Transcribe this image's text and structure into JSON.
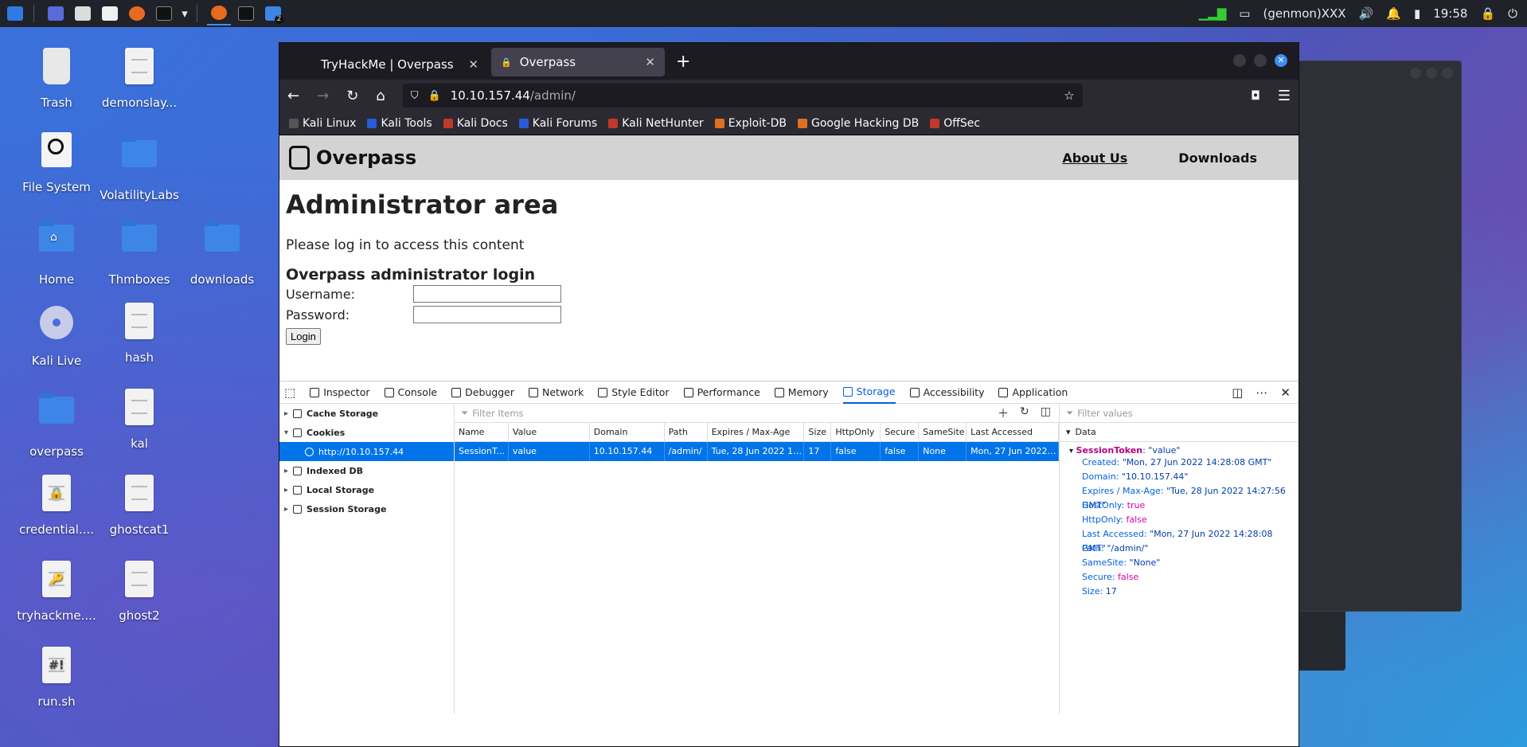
{
  "panel": {
    "status_text": "(genmon)XXX",
    "clock": "19:58",
    "workspace_badge": "2"
  },
  "desktop_icons": [
    {
      "label": "Trash",
      "type": "trash"
    },
    {
      "label": "demonslay...",
      "type": "doc"
    },
    {
      "label": "File System",
      "type": "drive"
    },
    {
      "label": "VolatilityLabs",
      "type": "folder"
    },
    {
      "label": "Home",
      "type": "home"
    },
    {
      "label": "Thmboxes",
      "type": "folder"
    },
    {
      "label": "downloads",
      "type": "folder"
    },
    {
      "label": "Kali Live",
      "type": "disc"
    },
    {
      "label": "hash",
      "type": "doc"
    },
    {
      "label": "overpass",
      "type": "folder"
    },
    {
      "label": "kal",
      "type": "doc"
    },
    {
      "label": "credential....",
      "type": "lockdoc"
    },
    {
      "label": "ghostcat1",
      "type": "doc"
    },
    {
      "label": "tryhackme....",
      "type": "keydoc"
    },
    {
      "label": "ghost2",
      "type": "doc"
    },
    {
      "label": "run.sh",
      "type": "script"
    }
  ],
  "browser": {
    "tabs": [
      {
        "title": "TryHackMe | Overpass"
      },
      {
        "title": "Overpass"
      }
    ],
    "url_host": "10.10.157.44",
    "url_path": "/admin/",
    "bookmarks": [
      "Kali Linux",
      "Kali Tools",
      "Kali Docs",
      "Kali Forums",
      "Kali NetHunter",
      "Exploit-DB",
      "Google Hacking DB",
      "OffSec"
    ]
  },
  "site": {
    "logo_text": "Overpass",
    "nav": [
      "About Us",
      "Downloads"
    ],
    "heading": "Administrator area",
    "message": "Please log in to access this content",
    "login_title": "Overpass administrator login",
    "username_label": "Username:",
    "password_label": "Password:",
    "login_button": "Login"
  },
  "devtools": {
    "tabs": [
      "Inspector",
      "Console",
      "Debugger",
      "Network",
      "Style Editor",
      "Performance",
      "Memory",
      "Storage",
      "Accessibility",
      "Application"
    ],
    "selected_tab": "Storage",
    "tree": [
      "Cache Storage",
      "Cookies",
      "http://10.10.157.44",
      "Indexed DB",
      "Local Storage",
      "Session Storage"
    ],
    "filter_items_placeholder": "Filter Items",
    "filter_values_placeholder": "Filter values",
    "columns": [
      "Name",
      "Value",
      "Domain",
      "Path",
      "Expires / Max-Age",
      "Size",
      "HttpOnly",
      "Secure",
      "SameSite",
      "Last Accessed"
    ],
    "row": [
      "SessionT...",
      "value",
      "10.10.157.44",
      "/admin/",
      "Tue, 28 Jun 2022 14:...",
      "17",
      "false",
      "false",
      "None",
      "Mon, 27 Jun 2022 14..."
    ],
    "data_header": "Data",
    "token_name": "SessionToken",
    "token_value": ": \"value\"",
    "details": [
      {
        "k": "Created",
        "v": "\"Mon, 27 Jun 2022 14:28:08 GMT\""
      },
      {
        "k": "Domain",
        "v": "\"10.10.157.44\""
      },
      {
        "k": "Expires / Max-Age",
        "v": "\"Tue, 28 Jun 2022 14:27:56 GMT\""
      },
      {
        "k": "HostOnly",
        "v": "true"
      },
      {
        "k": "HttpOnly",
        "v": "false"
      },
      {
        "k": "Last Accessed",
        "v": "\"Mon, 27 Jun 2022 14:28:08 GMT\""
      },
      {
        "k": "Path",
        "v": "\"/admin/\""
      },
      {
        "k": "SameSite",
        "v": "\"None\""
      },
      {
        "k": "Secure",
        "v": "false"
      },
      {
        "k": "Size",
        "v": "17"
      }
    ]
  }
}
